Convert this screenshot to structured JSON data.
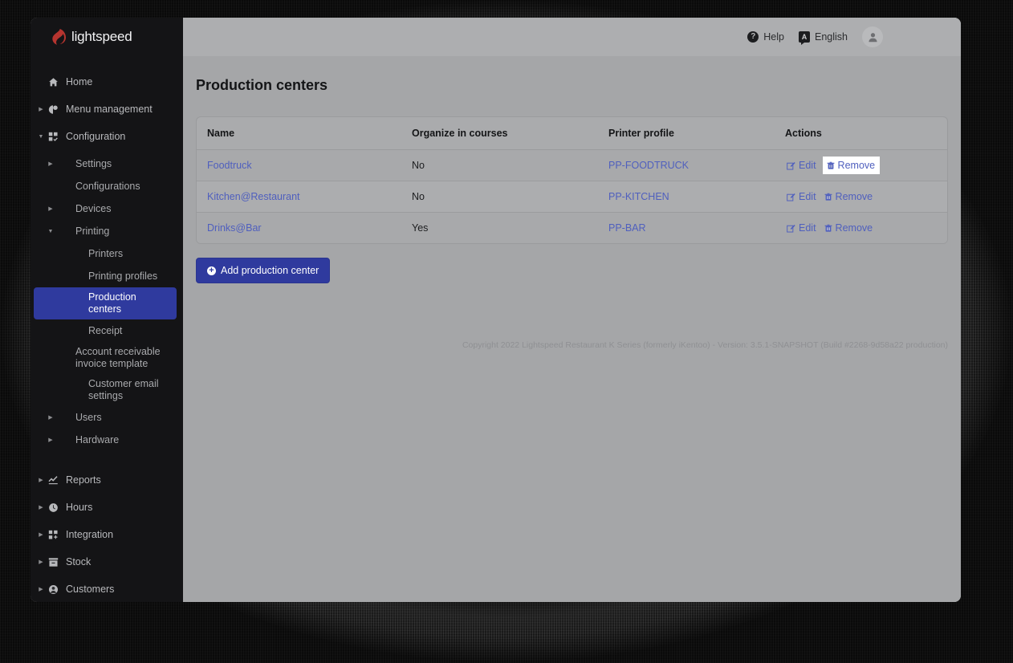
{
  "brand": {
    "name": "lightspeed",
    "logo_color": "#b5342f"
  },
  "sidebar": {
    "items": [
      {
        "label": "Home",
        "icon": "home-icon",
        "caret": "",
        "level": 0,
        "active": false
      },
      {
        "label": "Menu management",
        "icon": "menu-icon",
        "caret": "▶",
        "level": 0,
        "active": false
      },
      {
        "label": "Configuration",
        "icon": "config-icon",
        "caret": "▼",
        "level": 0,
        "active": false
      },
      {
        "label": "Settings",
        "icon": "",
        "caret": "▶",
        "level": 1,
        "active": false
      },
      {
        "label": "Configurations",
        "icon": "",
        "caret": "",
        "level": 1,
        "active": false
      },
      {
        "label": "Devices",
        "icon": "",
        "caret": "▶",
        "level": 1,
        "active": false
      },
      {
        "label": "Printing",
        "icon": "",
        "caret": "▼",
        "level": 1,
        "active": false
      },
      {
        "label": "Printers",
        "icon": "",
        "caret": "",
        "level": 2,
        "active": false
      },
      {
        "label": "Printing profiles",
        "icon": "",
        "caret": "",
        "level": 2,
        "active": false
      },
      {
        "label": "Production centers",
        "icon": "",
        "caret": "",
        "level": 2,
        "active": true
      },
      {
        "label": "Receipt",
        "icon": "",
        "caret": "",
        "level": 2,
        "active": false
      },
      {
        "label": "Account receivable\ninvoice template",
        "icon": "",
        "caret": "",
        "level": 1,
        "active": false
      },
      {
        "label": "Customer email settings",
        "icon": "",
        "caret": "",
        "level": 2,
        "active": false
      },
      {
        "label": "Users",
        "icon": "",
        "caret": "▶",
        "level": 1,
        "active": false
      },
      {
        "label": "Hardware",
        "icon": "",
        "caret": "▶",
        "level": 1,
        "active": false
      }
    ],
    "items_group2": [
      {
        "label": "Reports",
        "icon": "reports-icon",
        "caret": "▶"
      },
      {
        "label": "Hours",
        "icon": "hours-icon",
        "caret": "▶"
      },
      {
        "label": "Integration",
        "icon": "integration-icon",
        "caret": "▶"
      },
      {
        "label": "Stock",
        "icon": "stock-icon",
        "caret": "▶"
      },
      {
        "label": "Customers",
        "icon": "customers-icon",
        "caret": "▶"
      }
    ],
    "active_color": "#2f3a9e"
  },
  "topbar": {
    "help_label": "Help",
    "help_icon_glyph": "?",
    "language_label": "English",
    "language_icon_glyph": "A",
    "avatar_icon": "user-icon"
  },
  "page": {
    "title": "Production centers"
  },
  "table": {
    "headers": [
      "Name",
      "Organize in courses",
      "Printer profile",
      "Actions"
    ],
    "rows": [
      {
        "name": "Foodtruck",
        "organize": "No",
        "profile": "PP-FOODTRUCK",
        "edit": "Edit",
        "remove": "Remove",
        "remove_highlight": true
      },
      {
        "name": "Kitchen@Restaurant",
        "organize": "No",
        "profile": "PP-KITCHEN",
        "edit": "Edit",
        "remove": "Remove",
        "remove_highlight": false
      },
      {
        "name": "Drinks@Bar",
        "organize": "Yes",
        "profile": "PP-BAR",
        "edit": "Edit",
        "remove": "Remove",
        "remove_highlight": false
      }
    ]
  },
  "add_button": {
    "label": "Add production center",
    "icon": "plus-circle-icon"
  },
  "footer": {
    "text": "Copyright 2022 Lightspeed Restaurant K Series (formerly iKentoo) - Version: 3.5.1-SNAPSHOT (Build #2268-9d58a22 production)"
  }
}
